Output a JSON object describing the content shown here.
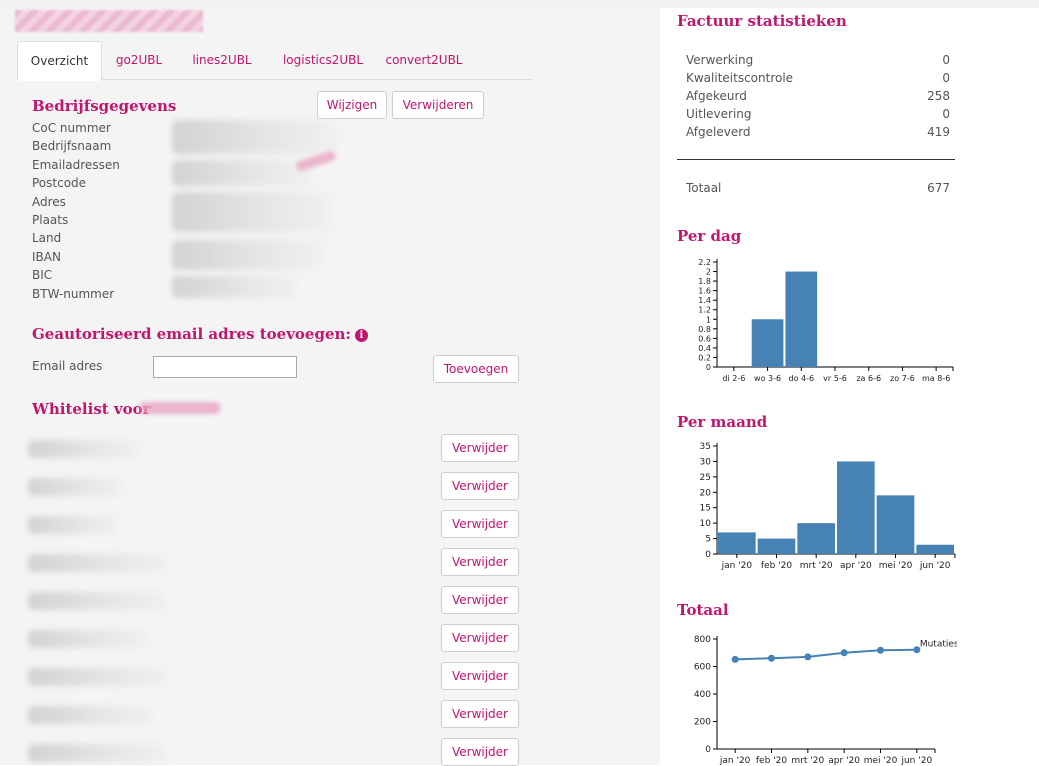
{
  "tabs": [
    "Overzicht",
    "go2UBL",
    "lines2UBL",
    "logistics2UBL",
    "convert2UBL"
  ],
  "company": {
    "title": "Bedrijfsgegevens",
    "edit_label": "Wijzigen",
    "delete_label": "Verwijderen",
    "fields": [
      "CoC nummer",
      "Bedrijfsnaam",
      "Emailadressen",
      "Postcode",
      "Adres",
      "Plaats",
      "Land",
      "IBAN",
      "BIC",
      "BTW-nummer"
    ]
  },
  "authorize": {
    "title": "Geautoriseerd email adres toevoegen:",
    "info_icon": "i",
    "email_label": "Email adres",
    "email_value": "",
    "add_label": "Toevoegen"
  },
  "whitelist": {
    "title": "Whitelist voor",
    "remove_label": "Verwijder",
    "count": 9
  },
  "stats": {
    "title": "Factuur statistieken",
    "rows": [
      {
        "label": "Verwerking",
        "value": "0"
      },
      {
        "label": "Kwaliteitscontrole",
        "value": "0"
      },
      {
        "label": "Afgekeurd",
        "value": "258"
      },
      {
        "label": "Uitlevering",
        "value": "0"
      },
      {
        "label": "Afgeleverd",
        "value": "419"
      }
    ],
    "total_label": "Totaal",
    "total_value": "677"
  },
  "colors": {
    "accent": "#c0166e",
    "bar": "#4682b4"
  },
  "chart_data": [
    {
      "type": "bar",
      "title": "Per dag",
      "categories": [
        "di 2-6",
        "wo 3-6",
        "do 4-6",
        "vr 5-6",
        "za 6-6",
        "zo 7-6",
        "ma 8-6"
      ],
      "values": [
        0,
        1,
        2,
        0,
        0,
        0,
        0
      ],
      "yticks": [
        "0",
        "0.2",
        "0.4",
        "0.6",
        "0.8",
        "1",
        "1.2",
        "1.4",
        "1.6",
        "1.8",
        "2",
        "2.2"
      ],
      "ylim": [
        0,
        2.2
      ]
    },
    {
      "type": "bar",
      "title": "Per maand",
      "categories": [
        "jan '20",
        "feb '20",
        "mrt '20",
        "apr '20",
        "mei '20",
        "jun '20"
      ],
      "values": [
        7,
        5,
        10,
        30,
        19,
        3
      ],
      "yticks": [
        "0",
        "5",
        "10",
        "15",
        "20",
        "25",
        "30",
        "35"
      ],
      "ylim": [
        0,
        35
      ]
    },
    {
      "type": "line",
      "title": "Totaal",
      "categories": [
        "jan '20",
        "feb '20",
        "mrt '20",
        "apr '20",
        "mei '20",
        "jun '20"
      ],
      "series": [
        {
          "name": "Mutaties",
          "values": [
            652,
            660,
            670,
            700,
            718,
            722
          ]
        }
      ],
      "yticks": [
        "0",
        "200",
        "400",
        "600",
        "800"
      ],
      "ylim": [
        0,
        800
      ]
    }
  ]
}
